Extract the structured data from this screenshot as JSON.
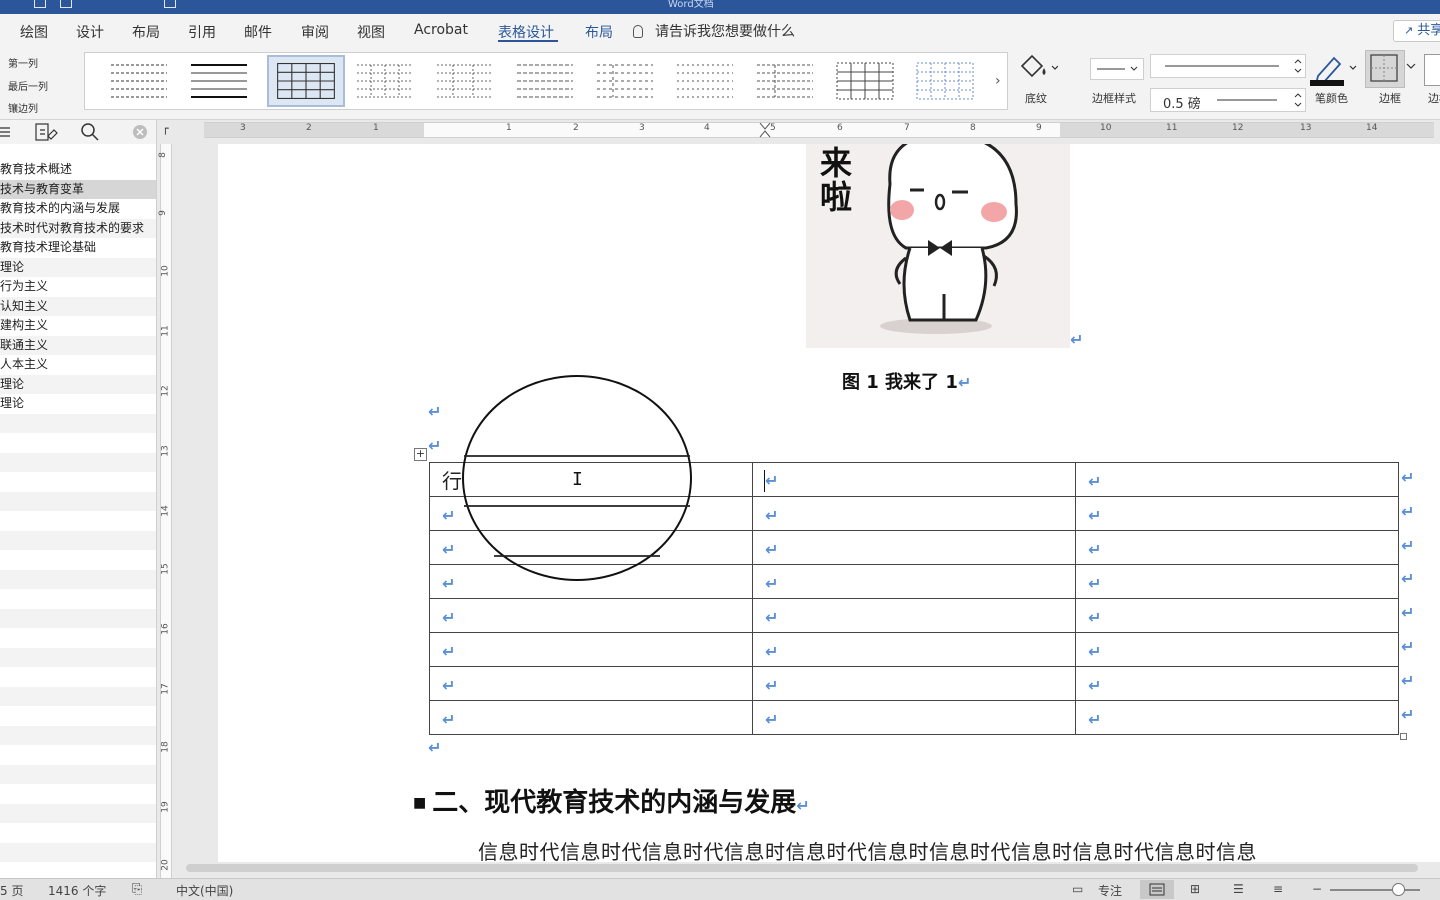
{
  "window": {
    "title": "Word文档"
  },
  "ribbon": {
    "tabs": [
      {
        "label": "绘图"
      },
      {
        "label": "设计"
      },
      {
        "label": "布局"
      },
      {
        "label": "引用"
      },
      {
        "label": "邮件"
      },
      {
        "label": "审阅"
      },
      {
        "label": "视图"
      },
      {
        "label": "Acrobat"
      },
      {
        "label": "表格设计",
        "active": true
      },
      {
        "label": "布局",
        "accent": true
      }
    ],
    "tell_me": "请告诉我您想要做什么",
    "share": "共享",
    "style_options": [
      "第一列",
      "最后一列",
      "镶边列"
    ],
    "shading_label": "底纹",
    "border_styles_label": "边框样式",
    "pen_weight": "0.5 磅",
    "pen_color_label": "笔颜色",
    "borders_label": "边框",
    "border_painter_label": "边框刷",
    "accent_color": "#2b579a",
    "icons": [
      "paint-bucket-icon",
      "pen-icon",
      "borders-icon",
      "share-icon",
      "lightbulb-icon"
    ]
  },
  "ruler": {
    "h_numbers": [
      "3",
      "2",
      "1",
      "1",
      "2",
      "3",
      "4",
      "5",
      "6",
      "7",
      "8",
      "9",
      "10",
      "11",
      "12",
      "13",
      "14"
    ],
    "v_numbers": [
      "8",
      "9",
      "10",
      "11",
      "12",
      "13",
      "14",
      "15",
      "16",
      "17",
      "18",
      "19",
      "20"
    ]
  },
  "nav": {
    "items": [
      {
        "label": "教育技术概述"
      },
      {
        "label": "技术与教育变革",
        "selected": true
      },
      {
        "label": "教育技术的内涵与发展"
      },
      {
        "label": "技术时代对教育技术的要求"
      },
      {
        "label": "教育技术理论基础"
      },
      {
        "label": "理论"
      },
      {
        "label": "行为主义"
      },
      {
        "label": "认知主义"
      },
      {
        "label": "建构主义"
      },
      {
        "label": "联通主义"
      },
      {
        "label": "人本主义"
      },
      {
        "label": "理论"
      },
      {
        "label": "理论"
      }
    ]
  },
  "document": {
    "image_text": "来啦",
    "caption": "图 1 我来了 1",
    "return_mark": "↵",
    "table": {
      "first_cell": "行",
      "rows": 8,
      "cols": 3
    },
    "heading": "二、现代教育技术的内涵与发展",
    "paragraph": "信息时代信息时代信息时代信息时信息时代信息时信息时代信息时信息时代信息时信息"
  },
  "status": {
    "page": "5 页",
    "words": "1416 个字",
    "language": "中文(中国)",
    "focus": "专注"
  }
}
